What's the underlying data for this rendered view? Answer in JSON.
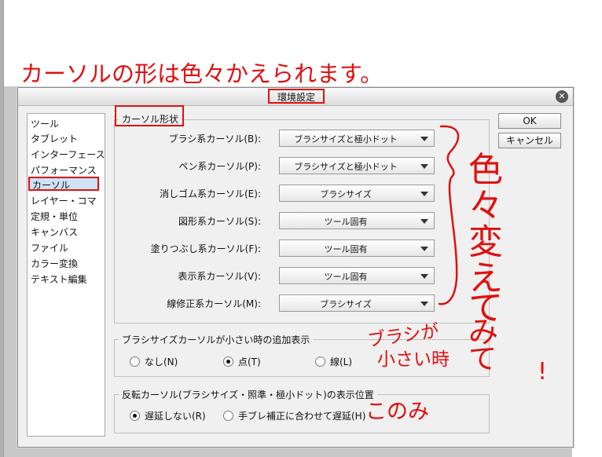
{
  "dialog": {
    "title": "環境設定",
    "close_icon": "close-icon",
    "ok_label": "OK",
    "cancel_label": "キャンセル"
  },
  "categories": [
    "ツール",
    "タブレット",
    "インターフェース",
    "パフォーマンス",
    "カーソル",
    "レイヤー・コマ",
    "定規・単位",
    "キャンバス",
    "ファイル",
    "カラー変換",
    "テキスト編集"
  ],
  "selected_category": "カーソル",
  "cursor_shape": {
    "legend": "カーソル形状",
    "rows": [
      {
        "label": "ブラシ系カーソル(B):",
        "value": "ブラシサイズと極小ドット"
      },
      {
        "label": "ペン系カーソル(P):",
        "value": "ブラシサイズと極小ドット"
      },
      {
        "label": "消しゴム系カーソル(E):",
        "value": "ブラシサイズ"
      },
      {
        "label": "図形系カーソル(S):",
        "value": "ツール固有"
      },
      {
        "label": "塗りつぶし系カーソル(F):",
        "value": "ツール固有"
      },
      {
        "label": "表示系カーソル(V):",
        "value": "ツール固有"
      },
      {
        "label": "線修正系カーソル(M):",
        "value": "ブラシサイズ"
      }
    ]
  },
  "small_brush": {
    "legend": "ブラシサイズカーソルが小さい時の追加表示",
    "options": [
      "なし(N)",
      "点(T)",
      "線(L)"
    ],
    "selected": "点(T)"
  },
  "invert_cursor": {
    "legend": "反転カーソル(ブラシサイズ・照準・極小ドット)の表示位置",
    "options": [
      "遅延しない(R)",
      "手ブレ補正に合わせて遅延(H)"
    ],
    "selected": "遅延しない(R)"
  },
  "annotations": {
    "headline": "カーソルの形は色々かえられます。",
    "vertical": [
      "色",
      "々",
      "変",
      "え",
      "て",
      "み",
      "て",
      "!"
    ],
    "small_brush_1": "ブラシが",
    "small_brush_2": "小さい時",
    "only": "このみ",
    "color": "#e01010"
  }
}
